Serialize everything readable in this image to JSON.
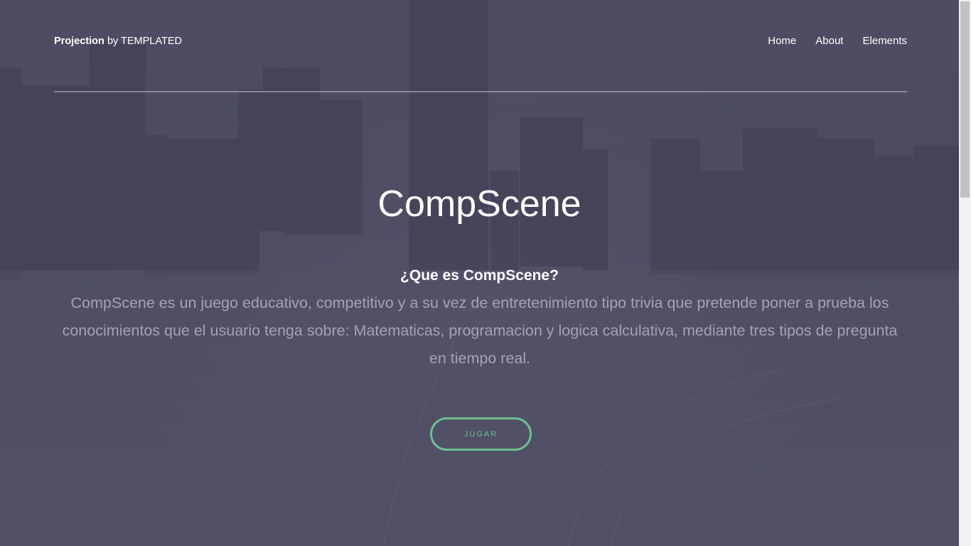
{
  "header": {
    "brand": "Projection",
    "by_text": "by TEMPLATED",
    "nav": [
      "Home",
      "About",
      "Elements"
    ]
  },
  "hero": {
    "title": "CompScene",
    "subtitle": "¿Que es CompScene?",
    "description": "CompScene es un juego educativo, competitivo y a su vez de entretenimiento tipo trivia que pretende poner a prueba los conocimientos que el usuario tenga sobre: Matematicas, programacion y logica calculativa, mediante tres tipos de pregunta en tiempo real.",
    "button_label": "JUGAR"
  },
  "colors": {
    "overlay": "#4e4d63",
    "accent": "#6cc091",
    "text": "#ffffff",
    "muted_text": "#a3a2b4"
  }
}
